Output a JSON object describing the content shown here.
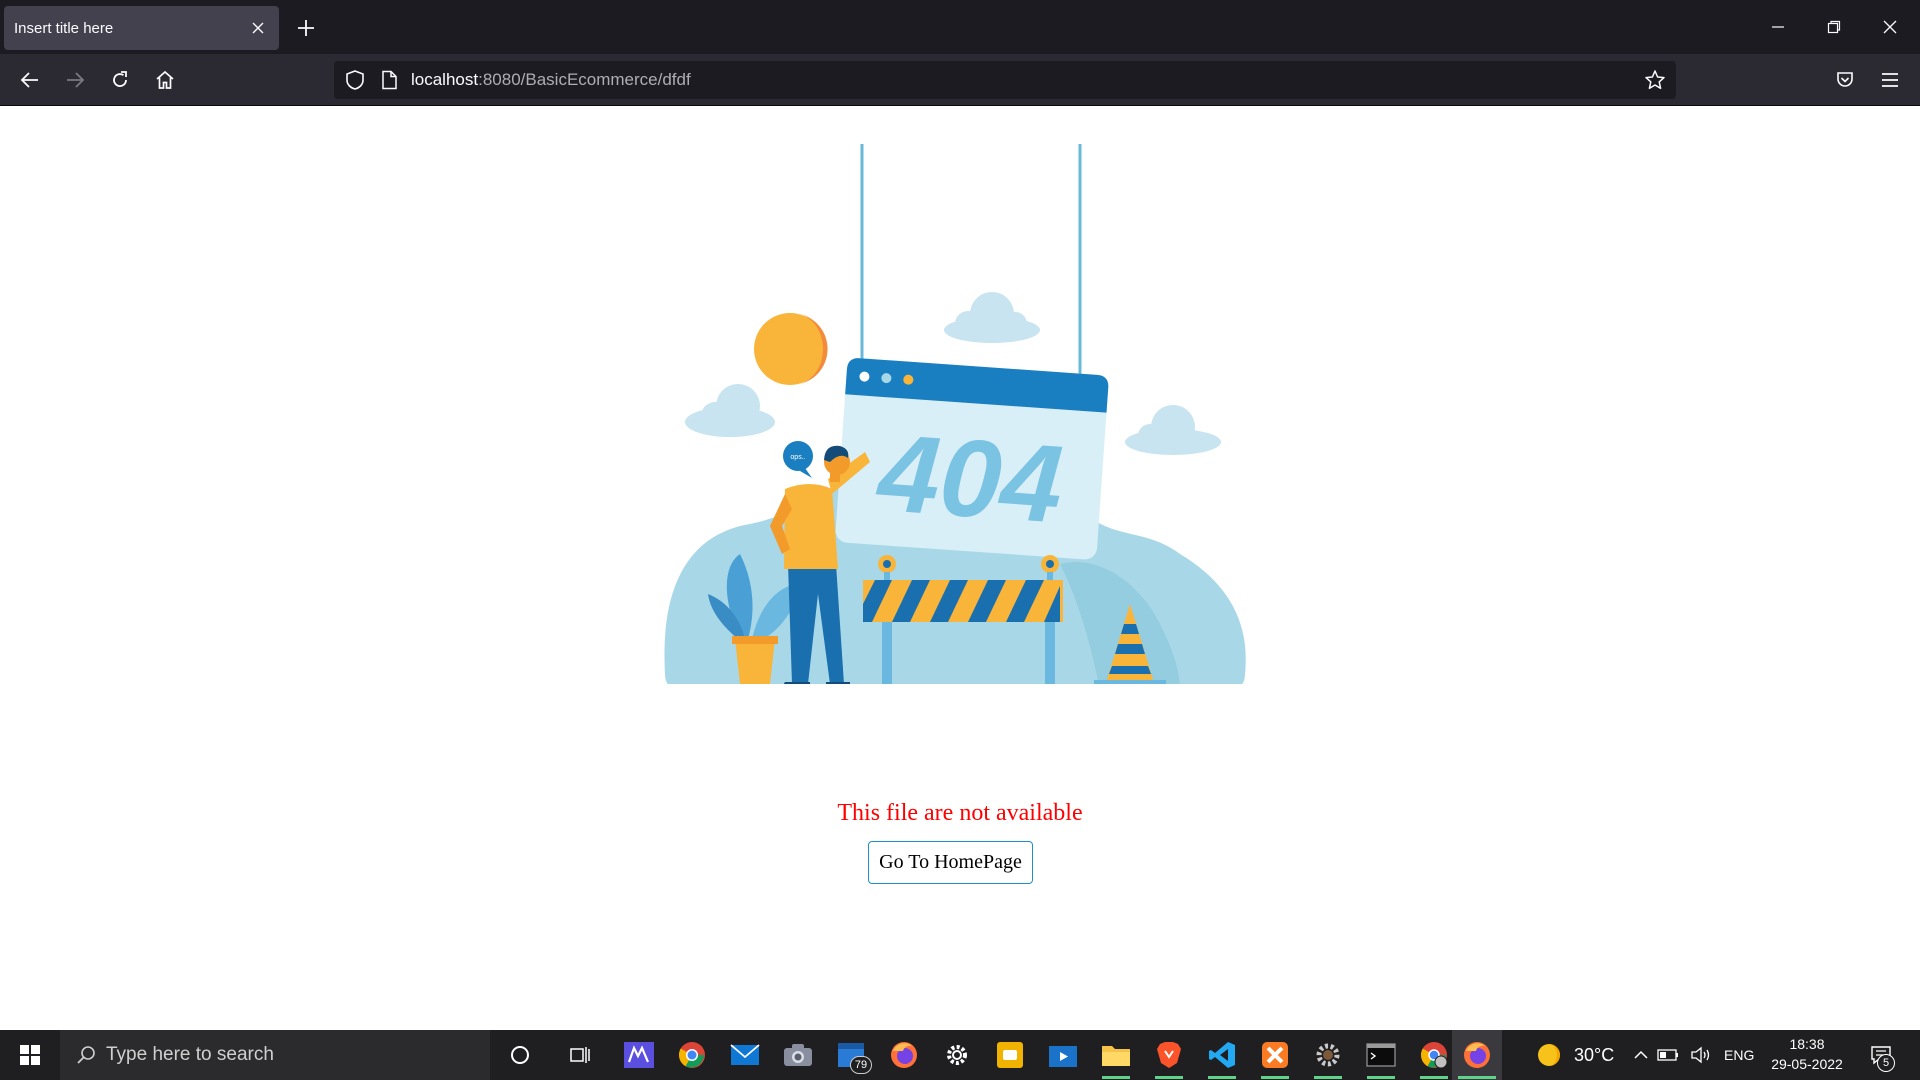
{
  "browser": {
    "tab_title": "Insert title here",
    "url_host": "localhost",
    "url_path": ":8080/BasicEcommerce/dfdf"
  },
  "illustration": {
    "sign_text": "404",
    "speech_bubble": "ops.."
  },
  "page": {
    "error_message": "This file are not available",
    "home_button": "Go To HomePage"
  },
  "taskbar": {
    "search_placeholder": "Type here to search",
    "mail_badge": "79",
    "temperature": "30°C",
    "language": "ENG",
    "time": "18:38",
    "date": "29-05-2022",
    "notification_count": "5",
    "apps": [
      "cortana-icon",
      "task-view-icon",
      "mathpix-icon",
      "chrome-icon",
      "mail-icon",
      "camera-icon",
      "calendar-icon",
      "firefox-icon",
      "settings-icon",
      "sticky-notes-icon",
      "movies-icon",
      "file-explorer-icon",
      "brave-icon",
      "vscode-icon",
      "xampp-icon",
      "gear-app-icon",
      "terminal-icon",
      "chrome-profile-icon",
      "firefox-active-icon"
    ]
  },
  "colors": {
    "accent": "#1e90c8",
    "error_text": "#ff0000",
    "illustration_light_blue": "#a8d8e8",
    "illustration_dark_blue": "#1a6fae",
    "illustration_yellow": "#f9b43a"
  }
}
